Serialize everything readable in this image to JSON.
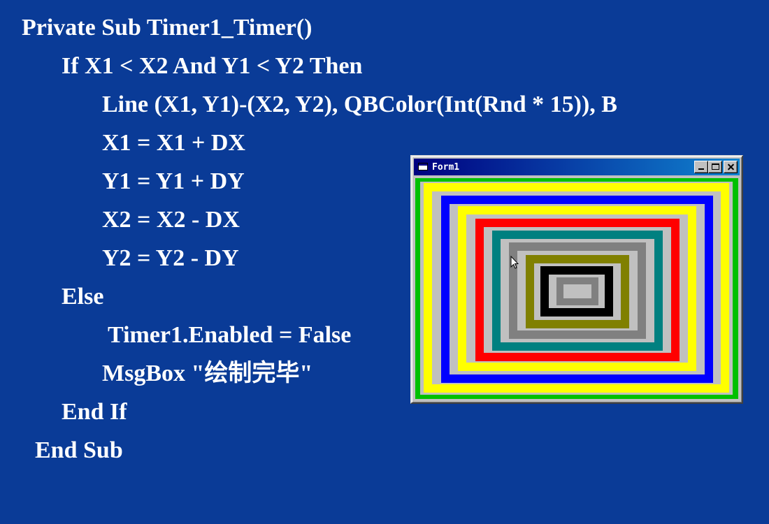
{
  "code": {
    "lines": [
      "Private Sub Timer1_Timer()",
      "If X1 < X2 And Y1 < Y2 Then",
      "Line (X1, Y1)-(X2, Y2), QBColor(Int(Rnd * 15)), B",
      "X1 = X1 + DX",
      "Y1 = Y1 + DY",
      "X2 = X2 - DX",
      "Y2 = Y2 - DY",
      "Else",
      "Timer1.Enabled = False",
      "MsgBox \"绘制完毕\"",
      "End If",
      "End Sub"
    ]
  },
  "form": {
    "title": "Form1",
    "icon": "form-window-icon",
    "buttons": [
      "minimize",
      "maximize",
      "close"
    ],
    "rectangle_colors": [
      "#00c000",
      "#ffff00",
      "#0000ff",
      "#ffff00",
      "#ff0000",
      "#008080",
      "#808080",
      "#808000",
      "#000000",
      "#808080"
    ],
    "rectangle_count": 10
  },
  "colors": {
    "slide_background": "#0a3b97",
    "code_text": "#ffffff",
    "titlebar_start": "#000080",
    "titlebar_end": "#1084d0",
    "form_background": "#c0c0c0"
  }
}
